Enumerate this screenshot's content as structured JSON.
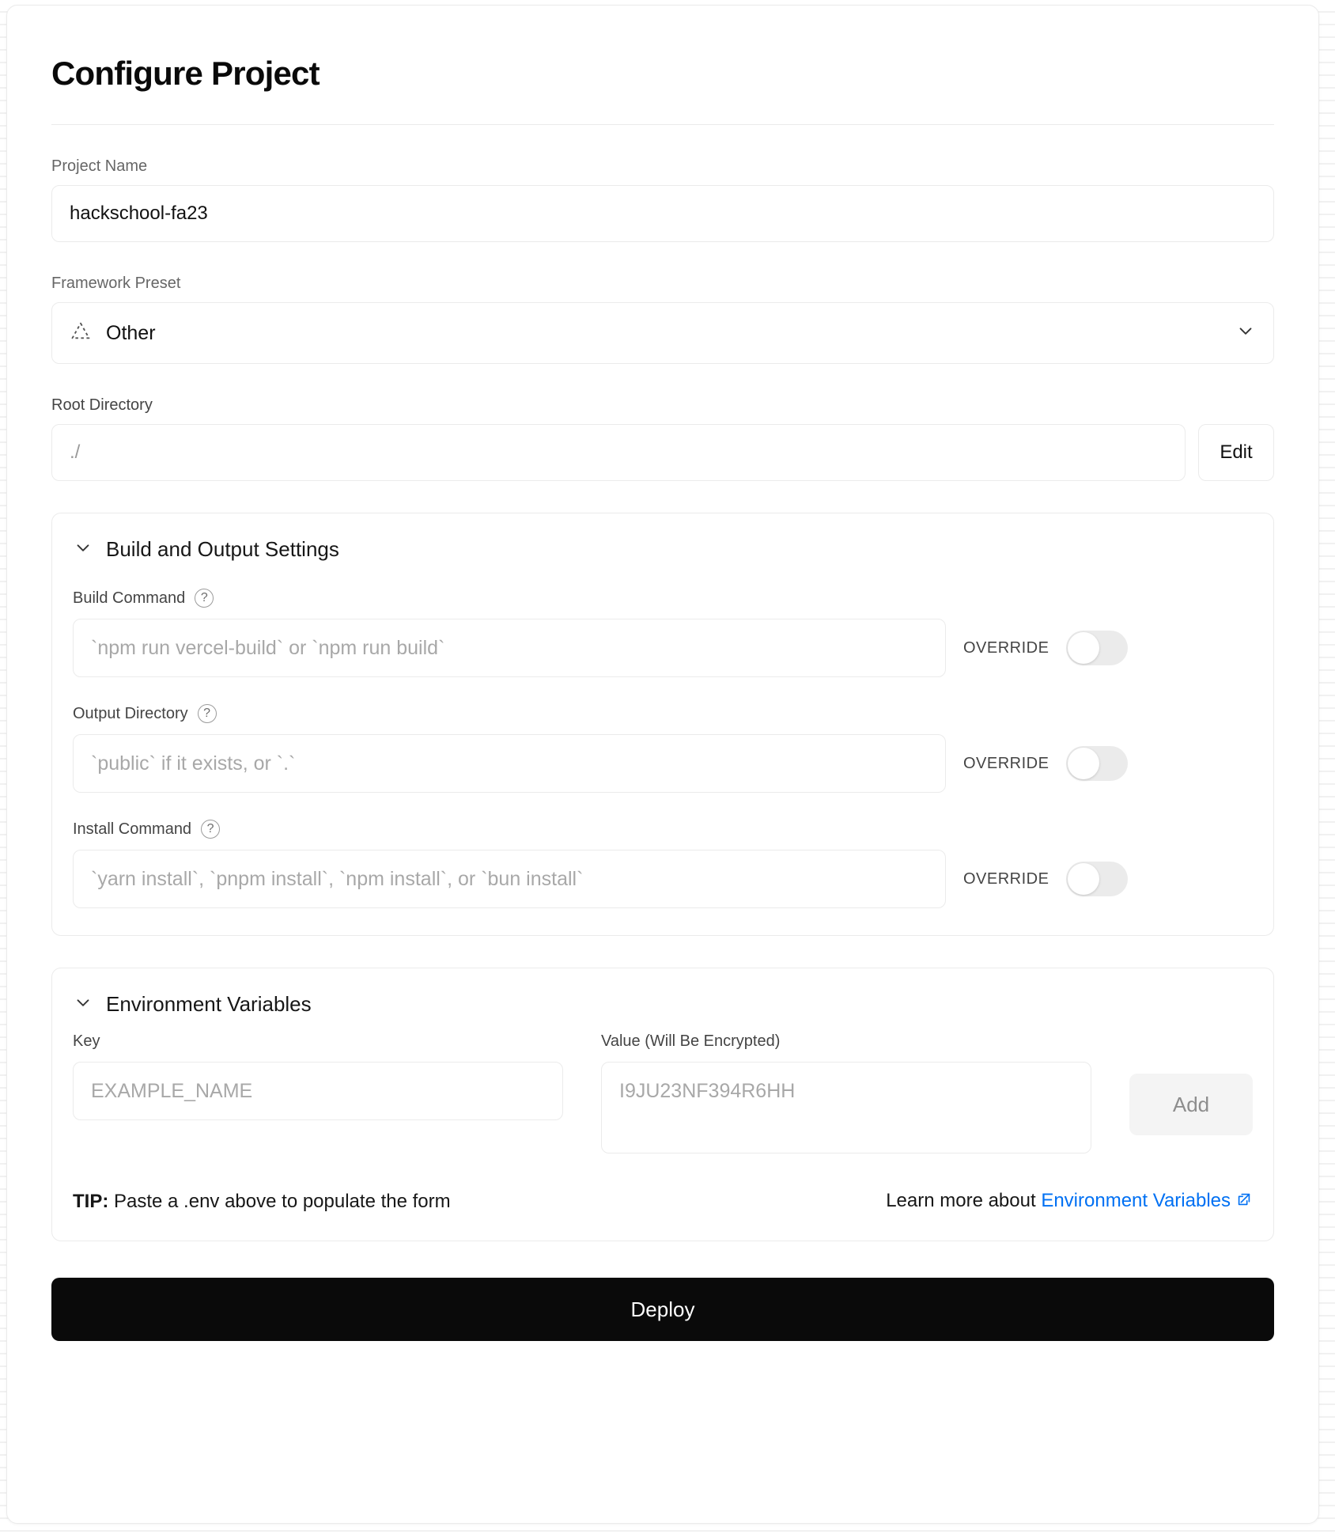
{
  "page": {
    "title": "Configure Project"
  },
  "project_name": {
    "label": "Project Name",
    "value": "hackschool-fa23"
  },
  "framework_preset": {
    "label": "Framework Preset",
    "value": "Other",
    "icon": "dashed-triangle-icon",
    "chevron": "chevron-down-icon"
  },
  "root_directory": {
    "label": "Root Directory",
    "value": "./",
    "edit_label": "Edit"
  },
  "build_settings": {
    "title": "Build and Output Settings",
    "collapse_icon": "chevron-down-icon",
    "fields": [
      {
        "label": "Build Command",
        "help": "?",
        "placeholder": "`npm run vercel-build` or `npm run build`",
        "override_label": "OVERRIDE",
        "override_on": false
      },
      {
        "label": "Output Directory",
        "help": "?",
        "placeholder": "`public` if it exists, or `.`",
        "override_label": "OVERRIDE",
        "override_on": false
      },
      {
        "label": "Install Command",
        "help": "?",
        "placeholder": "`yarn install`, `pnpm install`, `npm install`, or `bun install`",
        "override_label": "OVERRIDE",
        "override_on": false
      }
    ]
  },
  "environment_variables": {
    "title": "Environment Variables",
    "collapse_icon": "chevron-down-icon",
    "key_label": "Key",
    "key_placeholder": "EXAMPLE_NAME",
    "value_label": "Value (Will Be Encrypted)",
    "value_placeholder": "I9JU23NF394R6HH",
    "add_label": "Add",
    "tip_prefix": "TIP:",
    "tip_text": "Paste a .env above to populate the form",
    "learn_more_text": "Learn more about",
    "learn_more_link": "Environment Variables"
  },
  "deploy": {
    "label": "Deploy"
  },
  "colors": {
    "accent_link": "#0070f3",
    "deploy_bg": "#0a0a0a",
    "border": "#ebebeb"
  }
}
